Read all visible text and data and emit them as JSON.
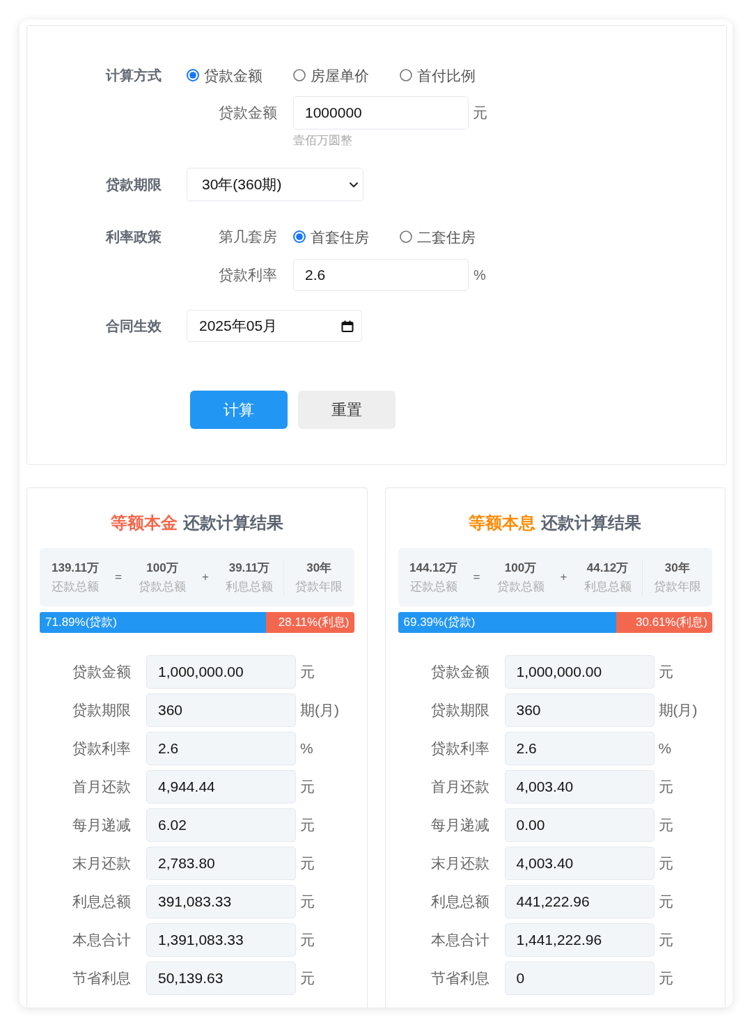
{
  "form": {
    "method": {
      "label": "计算方式",
      "options": [
        {
          "label": "贷款金额",
          "selected": true
        },
        {
          "label": "房屋单价",
          "selected": false
        },
        {
          "label": "首付比例",
          "selected": false
        }
      ]
    },
    "amount": {
      "label": "贷款金额",
      "value": "1000000",
      "unit": "元",
      "hint": "壹佰万圆整"
    },
    "term": {
      "label": "贷款期限",
      "value": "30年(360期)"
    },
    "rate_policy": {
      "label": "利率政策",
      "house": {
        "label": "第几套房",
        "options": [
          {
            "label": "首套住房",
            "selected": true
          },
          {
            "label": "二套住房",
            "selected": false
          }
        ]
      },
      "rate": {
        "label": "贷款利率",
        "value": "2.6",
        "unit": "%"
      }
    },
    "contract": {
      "label": "合同生效",
      "value": "2025年05月"
    },
    "buttons": [
      {
        "label": "计算",
        "kind": "primary"
      },
      {
        "label": "重置",
        "kind": "secondary"
      }
    ]
  },
  "results": [
    {
      "method": "等额本金",
      "color": "#f4664a",
      "title": "还款计算结果",
      "summary": [
        {
          "kind": "figure",
          "value": "139.11万",
          "caption": "还款总额"
        },
        {
          "kind": "operator",
          "symbol": "="
        },
        {
          "kind": "figure",
          "value": "100万",
          "caption": "贷款总额"
        },
        {
          "kind": "operator",
          "symbol": "+"
        },
        {
          "kind": "figure",
          "value": "39.11万",
          "caption": "利息总额"
        }
      ],
      "term": {
        "value": "30年",
        "caption": "贷款年限"
      },
      "split": {
        "level": 0.7189,
        "loan_label": "71.89%(贷款)",
        "interest_label": "28.11%(利息)"
      },
      "rows": [
        {
          "label": "贷款金额",
          "value": "1,000,000.00",
          "unit": "元"
        },
        {
          "label": "贷款期限",
          "value": "360",
          "unit": "期(月)"
        },
        {
          "label": "贷款利率",
          "value": "2.6",
          "unit": "%"
        },
        {
          "label": "首月还款",
          "value": "4,944.44",
          "unit": "元"
        },
        {
          "label": "每月递减",
          "value": "6.02",
          "unit": "元"
        },
        {
          "label": "末月还款",
          "value": "2,783.80",
          "unit": "元"
        },
        {
          "label": "利息总额",
          "value": "391,083.33",
          "unit": "元"
        },
        {
          "label": "本息合计",
          "value": "1,391,083.33",
          "unit": "元"
        },
        {
          "label": "节省利息",
          "value": "50,139.63",
          "unit": "元"
        }
      ]
    },
    {
      "method": "等额本息",
      "color": "#ff8a00",
      "title": "还款计算结果",
      "summary": [
        {
          "kind": "figure",
          "value": "144.12万",
          "caption": "还款总额"
        },
        {
          "kind": "operator",
          "symbol": "="
        },
        {
          "kind": "figure",
          "value": "100万",
          "caption": "贷款总额"
        },
        {
          "kind": "operator",
          "symbol": "+"
        },
        {
          "kind": "figure",
          "value": "44.12万",
          "caption": "利息总额"
        }
      ],
      "term": {
        "value": "30年",
        "caption": "贷款年限"
      },
      "split": {
        "level": 0.6939,
        "loan_label": "69.39%(贷款)",
        "interest_label": "30.61%(利息)"
      },
      "rows": [
        {
          "label": "贷款金额",
          "value": "1,000,000.00",
          "unit": "元"
        },
        {
          "label": "贷款期限",
          "value": "360",
          "unit": "期(月)"
        },
        {
          "label": "贷款利率",
          "value": "2.6",
          "unit": "%"
        },
        {
          "label": "首月还款",
          "value": "4,003.40",
          "unit": "元"
        },
        {
          "label": "每月递减",
          "value": "0.00",
          "unit": "元"
        },
        {
          "label": "末月还款",
          "value": "4,003.40",
          "unit": "元"
        },
        {
          "label": "利息总额",
          "value": "441,222.96",
          "unit": "元"
        },
        {
          "label": "本息合计",
          "value": "1,441,222.96",
          "unit": "元"
        },
        {
          "label": "节省利息",
          "value": "0",
          "unit": "元"
        }
      ]
    }
  ]
}
